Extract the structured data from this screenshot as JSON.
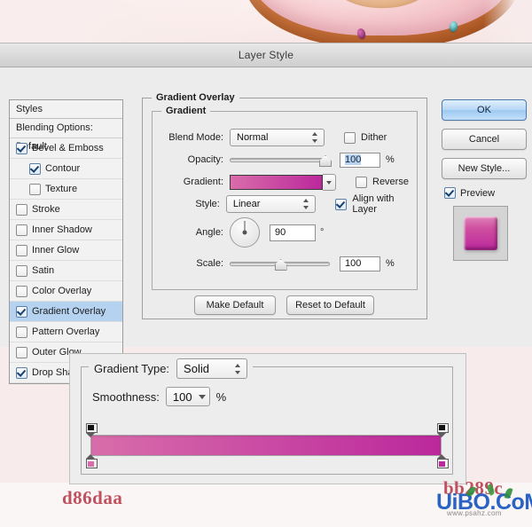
{
  "window": {
    "title": "Layer Style"
  },
  "photo": {
    "alt": "donut-photo-strip"
  },
  "styles_panel": {
    "header": "Styles",
    "blending_options": "Blending Options: Default",
    "items": [
      {
        "label": "Bevel & Emboss",
        "checked": true,
        "indent": false,
        "selected": false
      },
      {
        "label": "Contour",
        "checked": true,
        "indent": true,
        "selected": false
      },
      {
        "label": "Texture",
        "checked": false,
        "indent": true,
        "selected": false
      },
      {
        "label": "Stroke",
        "checked": false,
        "indent": false,
        "selected": false
      },
      {
        "label": "Inner Shadow",
        "checked": false,
        "indent": false,
        "selected": false
      },
      {
        "label": "Inner Glow",
        "checked": false,
        "indent": false,
        "selected": false
      },
      {
        "label": "Satin",
        "checked": false,
        "indent": false,
        "selected": false
      },
      {
        "label": "Color Overlay",
        "checked": false,
        "indent": false,
        "selected": false
      },
      {
        "label": "Gradient Overlay",
        "checked": true,
        "indent": false,
        "selected": true
      },
      {
        "label": "Pattern Overlay",
        "checked": false,
        "indent": false,
        "selected": false
      },
      {
        "label": "Outer Glow",
        "checked": false,
        "indent": false,
        "selected": false
      },
      {
        "label": "Drop Shadow",
        "checked": true,
        "indent": false,
        "selected": false
      }
    ]
  },
  "gradient_overlay": {
    "group_title": "Gradient Overlay",
    "subgroup_title": "Gradient",
    "blend_mode": {
      "label": "Blend Mode:",
      "value": "Normal"
    },
    "dither": {
      "label": "Dither",
      "checked": false
    },
    "opacity": {
      "label": "Opacity:",
      "value": "100",
      "unit": "%",
      "slider_pct": 100
    },
    "gradient": {
      "label": "Gradient:",
      "start_color": "#d86daa",
      "end_color": "#bb289c"
    },
    "reverse": {
      "label": "Reverse",
      "checked": false
    },
    "style": {
      "label": "Style:",
      "value": "Linear"
    },
    "align_with_layer": {
      "label": "Align with Layer",
      "checked": true
    },
    "angle": {
      "label": "Angle:",
      "value": "90",
      "unit": "°"
    },
    "scale": {
      "label": "Scale:",
      "value": "100",
      "unit": "%",
      "slider_pct": 50
    },
    "make_default": "Make Default",
    "reset_to_default": "Reset to Default"
  },
  "buttons": {
    "ok": "OK",
    "cancel": "Cancel",
    "new_style": "New Style...",
    "preview": {
      "label": "Preview",
      "checked": true
    }
  },
  "gradient_editor": {
    "gradient_type": {
      "label": "Gradient Type:",
      "value": "Solid"
    },
    "smoothness": {
      "label": "Smoothness:",
      "value": "100",
      "unit": "%"
    },
    "opacity_stops": [
      {
        "position_pct": 0,
        "color": "#111111"
      },
      {
        "position_pct": 100,
        "color": "#111111"
      }
    ],
    "color_stops": [
      {
        "position_pct": 0,
        "color": "#d86daa"
      },
      {
        "position_pct": 100,
        "color": "#bb289c"
      }
    ]
  },
  "captions": {
    "hex_left": "d86daa",
    "hex_right": "bb289c"
  },
  "watermark": {
    "text": "UiBO.CoM",
    "subtext": "www.psahz.com"
  }
}
